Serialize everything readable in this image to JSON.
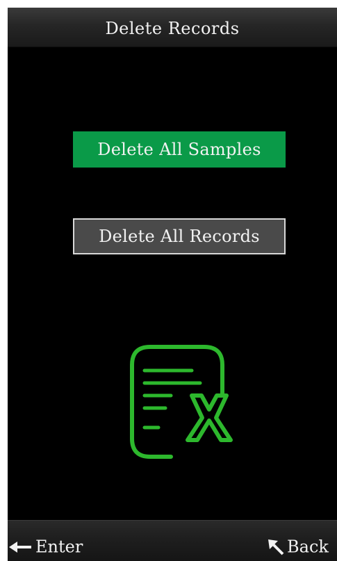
{
  "header": {
    "title": "Delete Records"
  },
  "menu": {
    "items": [
      {
        "label": "Delete All Samples",
        "selected": true
      },
      {
        "label": "Delete All Records",
        "selected": false
      }
    ]
  },
  "illustration": {
    "icon": "delete-document-icon"
  },
  "footer": {
    "enter_label": "Enter",
    "enter_icon": "enter-arrow-icon",
    "back_label": "Back",
    "back_icon": "back-arrow-icon"
  },
  "colors": {
    "selected_item": "#0a9a48",
    "unselected_item": "#4a4a4a",
    "icon_green": "#2db82d",
    "background": "#000000"
  }
}
